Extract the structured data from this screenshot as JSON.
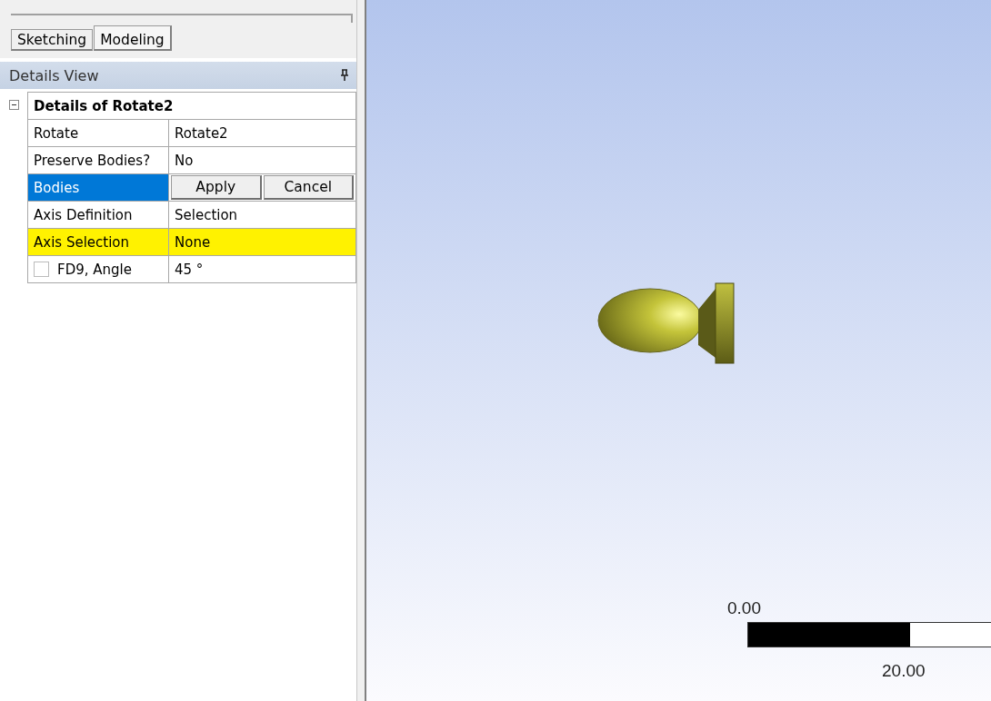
{
  "tabs": [
    {
      "label": "Sketching",
      "selected": false
    },
    {
      "label": "Modeling",
      "selected": true
    }
  ],
  "details_view": {
    "title": "Details View",
    "rows": [
      {
        "kind": "header",
        "label": "Details of Rotate2",
        "expanded": true
      },
      {
        "kind": "property",
        "label": "Rotate",
        "value": "Rotate2",
        "selected": false,
        "missing": false
      },
      {
        "kind": "property",
        "label": "Preserve Bodies?",
        "value": "No",
        "selected": false,
        "missing": false
      },
      {
        "kind": "buttons",
        "label": "Bodies",
        "selected": true,
        "buttons": [
          "Apply",
          "Cancel"
        ]
      },
      {
        "kind": "property",
        "label": "Axis Definition",
        "value": "Selection",
        "selected": false,
        "missing": false
      },
      {
        "kind": "property",
        "label": "Axis Selection",
        "value": "None",
        "selected": false,
        "missing": true
      },
      {
        "kind": "checkbox",
        "label": "FD9, Angle",
        "value": "45 °",
        "checked": false,
        "selected": false,
        "missing": false
      }
    ]
  },
  "viewport": {
    "scale_bar": {
      "start_label": "0.00",
      "end_label": "20.00"
    }
  }
}
